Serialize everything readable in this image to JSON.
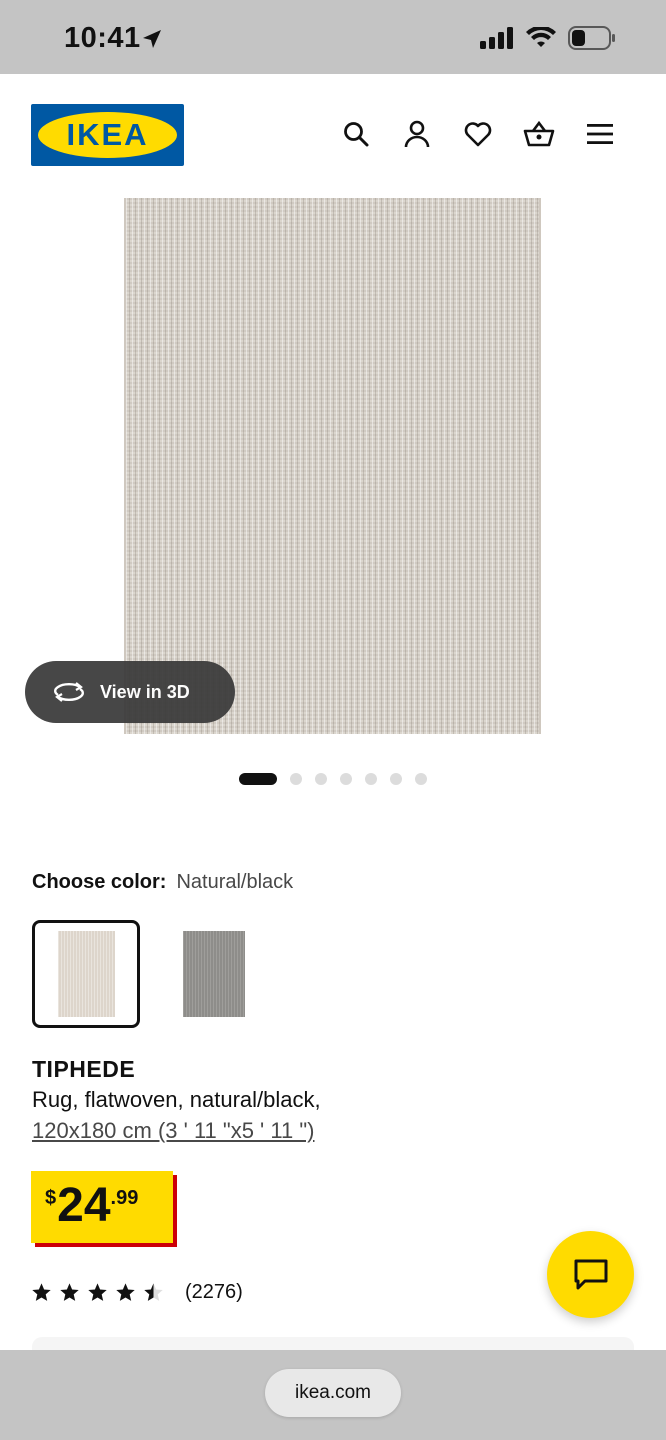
{
  "status": {
    "time": "10:41",
    "battery_level": 0.3,
    "icons": [
      "location-arrow-icon",
      "cellular-signal-icon",
      "wifi-icon",
      "battery-icon"
    ]
  },
  "header": {
    "logo_text": "IKEA",
    "icons": [
      "search-icon",
      "account-icon",
      "heart-icon",
      "basket-icon",
      "menu-icon"
    ]
  },
  "gallery": {
    "view3d_label": "View in 3D",
    "image_count": 7,
    "active_index": 0
  },
  "color_picker": {
    "label": "Choose color:",
    "value": "Natural/black"
  },
  "product": {
    "name": "TIPHEDE",
    "description": "Rug, flatwoven, natural/black,",
    "size": "120x180 cm (3 ' 11 \"x5 ' 11 \")",
    "price_currency": "$",
    "price_integer": "24",
    "price_decimal": ".99",
    "rating": 4.5,
    "review_count": "(2276)"
  },
  "browser": {
    "url": "ikea.com"
  },
  "colors": {
    "ikea_blue": "#0058a3",
    "ikea_yellow": "#ffdb00",
    "price_shadow_red": "#cc0008"
  }
}
